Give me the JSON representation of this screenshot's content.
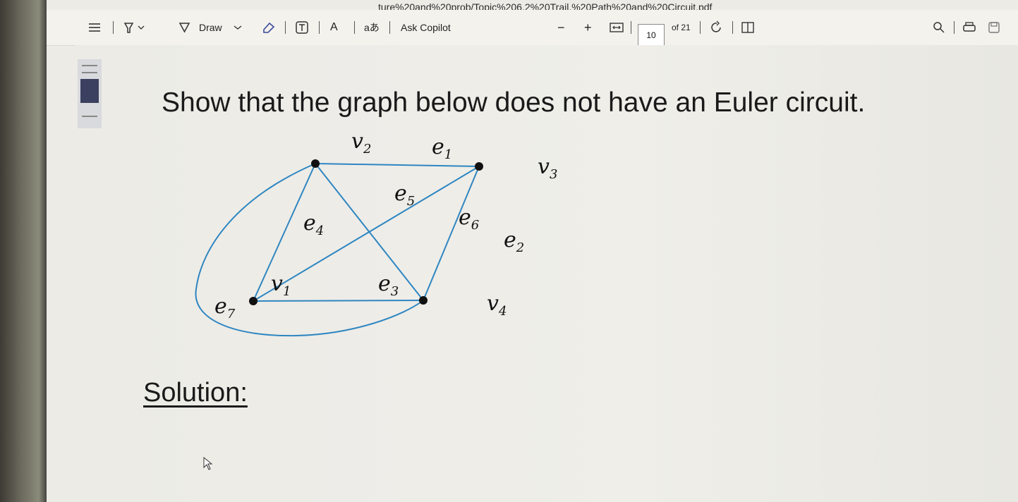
{
  "window": {
    "url_fragment": "ture%20and%20prob/Topic%206.2%20Trail,%20Path%20and%20Circuit.pdf"
  },
  "toolbar": {
    "contents_icon": "contents-list-icon",
    "highlight_icon": "highlighter-icon",
    "draw_label": "Draw",
    "erase_icon": "eraser-icon",
    "text_icon": "text-box-icon",
    "text_size_icon": "A",
    "read_aloud_icon": "aあ",
    "copilot_label": "Ask Copilot",
    "zoom_out": "−",
    "zoom_in": "+",
    "page_current": "10",
    "page_total": "of 21",
    "search_icon": "search-icon",
    "print_icon": "print-icon",
    "save_icon": "save-icon"
  },
  "page": {
    "question": "Show that the graph below does not have an Euler circuit.",
    "solution_heading": "Solution:"
  },
  "graph": {
    "vertices": [
      {
        "id": "v1",
        "name": "v",
        "sub": "1"
      },
      {
        "id": "v2",
        "name": "v",
        "sub": "2"
      },
      {
        "id": "v3",
        "name": "v",
        "sub": "3"
      },
      {
        "id": "v4",
        "name": "v",
        "sub": "4"
      }
    ],
    "edges": [
      {
        "id": "e1",
        "name": "e",
        "sub": "1",
        "from": "v2",
        "to": "v3"
      },
      {
        "id": "e2",
        "name": "e",
        "sub": "2",
        "from": "v3",
        "to": "v4"
      },
      {
        "id": "e3",
        "name": "e",
        "sub": "3",
        "from": "v1",
        "to": "v4"
      },
      {
        "id": "e4",
        "name": "e",
        "sub": "4",
        "from": "v1",
        "to": "v2"
      },
      {
        "id": "e5",
        "name": "e",
        "sub": "5",
        "from": "v2",
        "to": "v4"
      },
      {
        "id": "e6",
        "name": "e",
        "sub": "6",
        "from": "v1",
        "to": "v3"
      },
      {
        "id": "e7",
        "name": "e",
        "sub": "7",
        "from": "v2",
        "to": "v4"
      }
    ],
    "edge_color": "#2e86c1",
    "vertex_color": "#111111"
  }
}
